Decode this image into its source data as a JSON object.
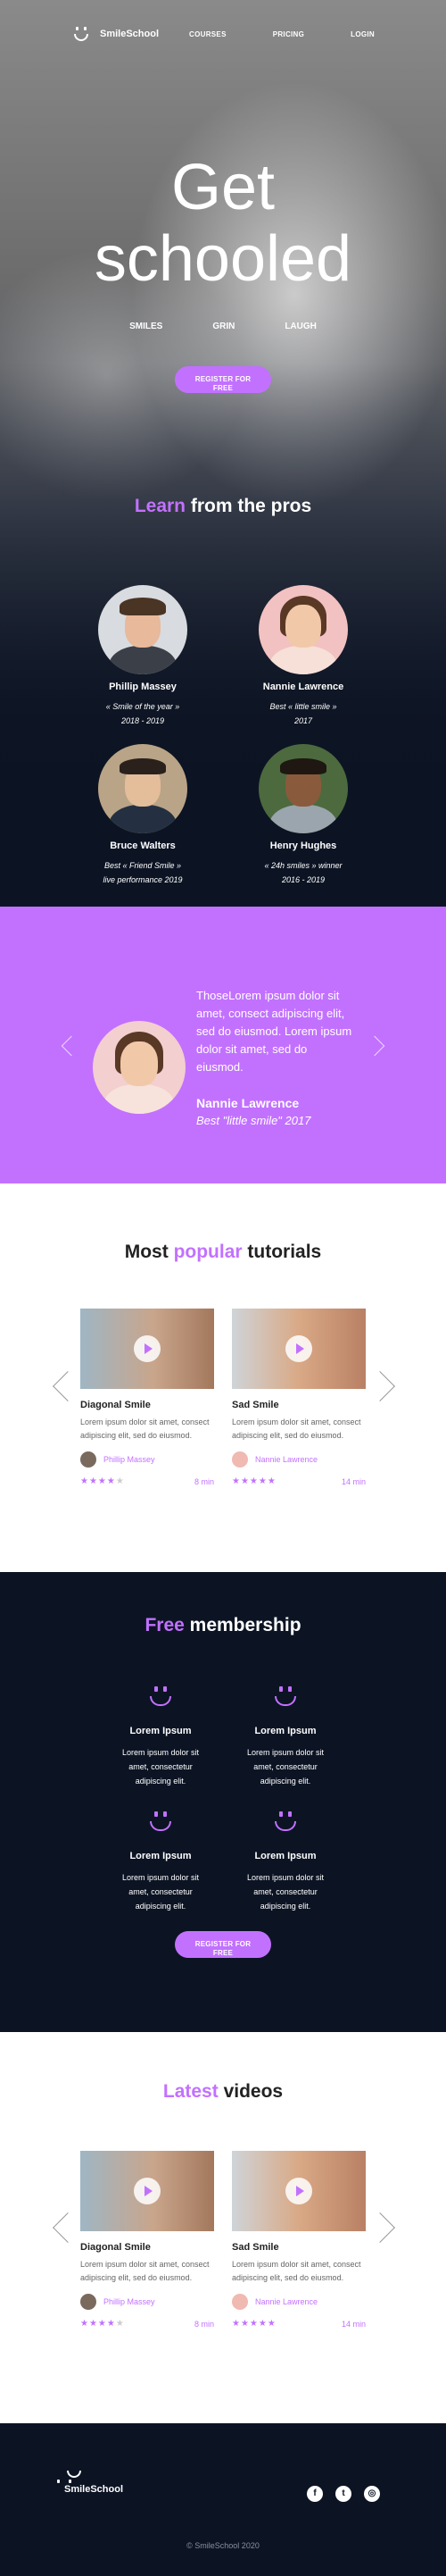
{
  "nav": {
    "logo_text": "SmileSchool",
    "links": [
      "COURSES",
      "PRICING",
      "LOGIN"
    ]
  },
  "hero": {
    "title_line1": "Get",
    "title_line2": "schooled",
    "tags": [
      "SMILES",
      "GRIN",
      "LAUGH"
    ],
    "button": "REGISTER FOR FREE"
  },
  "pros": {
    "title_accent": "Learn",
    "title_rest": " from the pros",
    "items": [
      {
        "name": "Phillip Massey",
        "quote_line1": "« Smile of the year »",
        "quote_line2": "2018 - 2019"
      },
      {
        "name": "Nannie Lawrence",
        "quote_line1": "Best « little smile »",
        "quote_line2": "2017"
      },
      {
        "name": "Bruce Walters",
        "quote_line1": "Best « Friend Smile »",
        "quote_line2": "live performance 2019"
      },
      {
        "name": "Henry Hughes",
        "quote_line1": "« 24h smiles » winner",
        "quote_line2": "2016 - 2019"
      }
    ]
  },
  "testimonial": {
    "text": "ThoseLorem ipsum dolor sit amet, consect adipiscing elit, sed do eiusmod. Lorem ipsum dolor sit amet, sed do eiusmod.",
    "name": "Nannie Lawrence",
    "title": "Best \"little smile\" 2017"
  },
  "tutorials": {
    "title_pre": "Most ",
    "title_accent": "popular",
    "title_post": " tutorials",
    "cards": [
      {
        "title": "Diagonal Smile",
        "desc": "Lorem ipsum dolor sit amet, consect adipiscing elit, sed do eiusmod.",
        "author": "Phillip Massey",
        "rating": 4,
        "duration": "8 min"
      },
      {
        "title": "Sad Smile",
        "desc": "Lorem ipsum dolor sit amet, consect adipiscing elit, sed do eiusmod.",
        "author": "Nannie Lawrence",
        "rating": 5,
        "duration": "14 min"
      }
    ]
  },
  "membership": {
    "title_accent": "Free",
    "title_rest": " membership",
    "features": [
      {
        "title": "Lorem Ipsum",
        "desc_line1": "Lorem ipsum dolor sit",
        "desc_line2": "amet, consectetur",
        "desc_line3": "adipiscing elit."
      },
      {
        "title": "Lorem Ipsum",
        "desc_line1": "Lorem ipsum dolor sit",
        "desc_line2": "amet, consectetur",
        "desc_line3": "adipiscing elit."
      },
      {
        "title": "Lorem Ipsum",
        "desc_line1": "Lorem ipsum dolor sit",
        "desc_line2": "amet, consectetur",
        "desc_line3": "adipiscing elit."
      },
      {
        "title": "Lorem Ipsum",
        "desc_line1": "Lorem ipsum dolor sit",
        "desc_line2": "amet, consectetur",
        "desc_line3": "adipiscing elit."
      }
    ],
    "button": "REGISTER FOR FREE"
  },
  "latest": {
    "title_accent": "Latest",
    "title_rest": " videos",
    "cards": [
      {
        "title": "Diagonal Smile",
        "desc": "Lorem ipsum dolor sit amet, consect adipiscing elit, sed do eiusmod.",
        "author": "Phillip Massey",
        "rating": 4,
        "duration": "8 min"
      },
      {
        "title": "Sad Smile",
        "desc": "Lorem ipsum dolor sit amet, consect adipiscing elit, sed do eiusmod.",
        "author": "Nannie Lawrence",
        "rating": 5,
        "duration": "14 min"
      }
    ]
  },
  "footer": {
    "logo_text": "SmileSchool",
    "socials": [
      "facebook-icon",
      "twitter-icon",
      "instagram-icon"
    ],
    "social_glyphs": [
      "f",
      "t",
      "◎"
    ],
    "copyright": "© SmileSchool 2020"
  },
  "colors": {
    "accent": "#c271ff",
    "dark": "#0c1424"
  }
}
